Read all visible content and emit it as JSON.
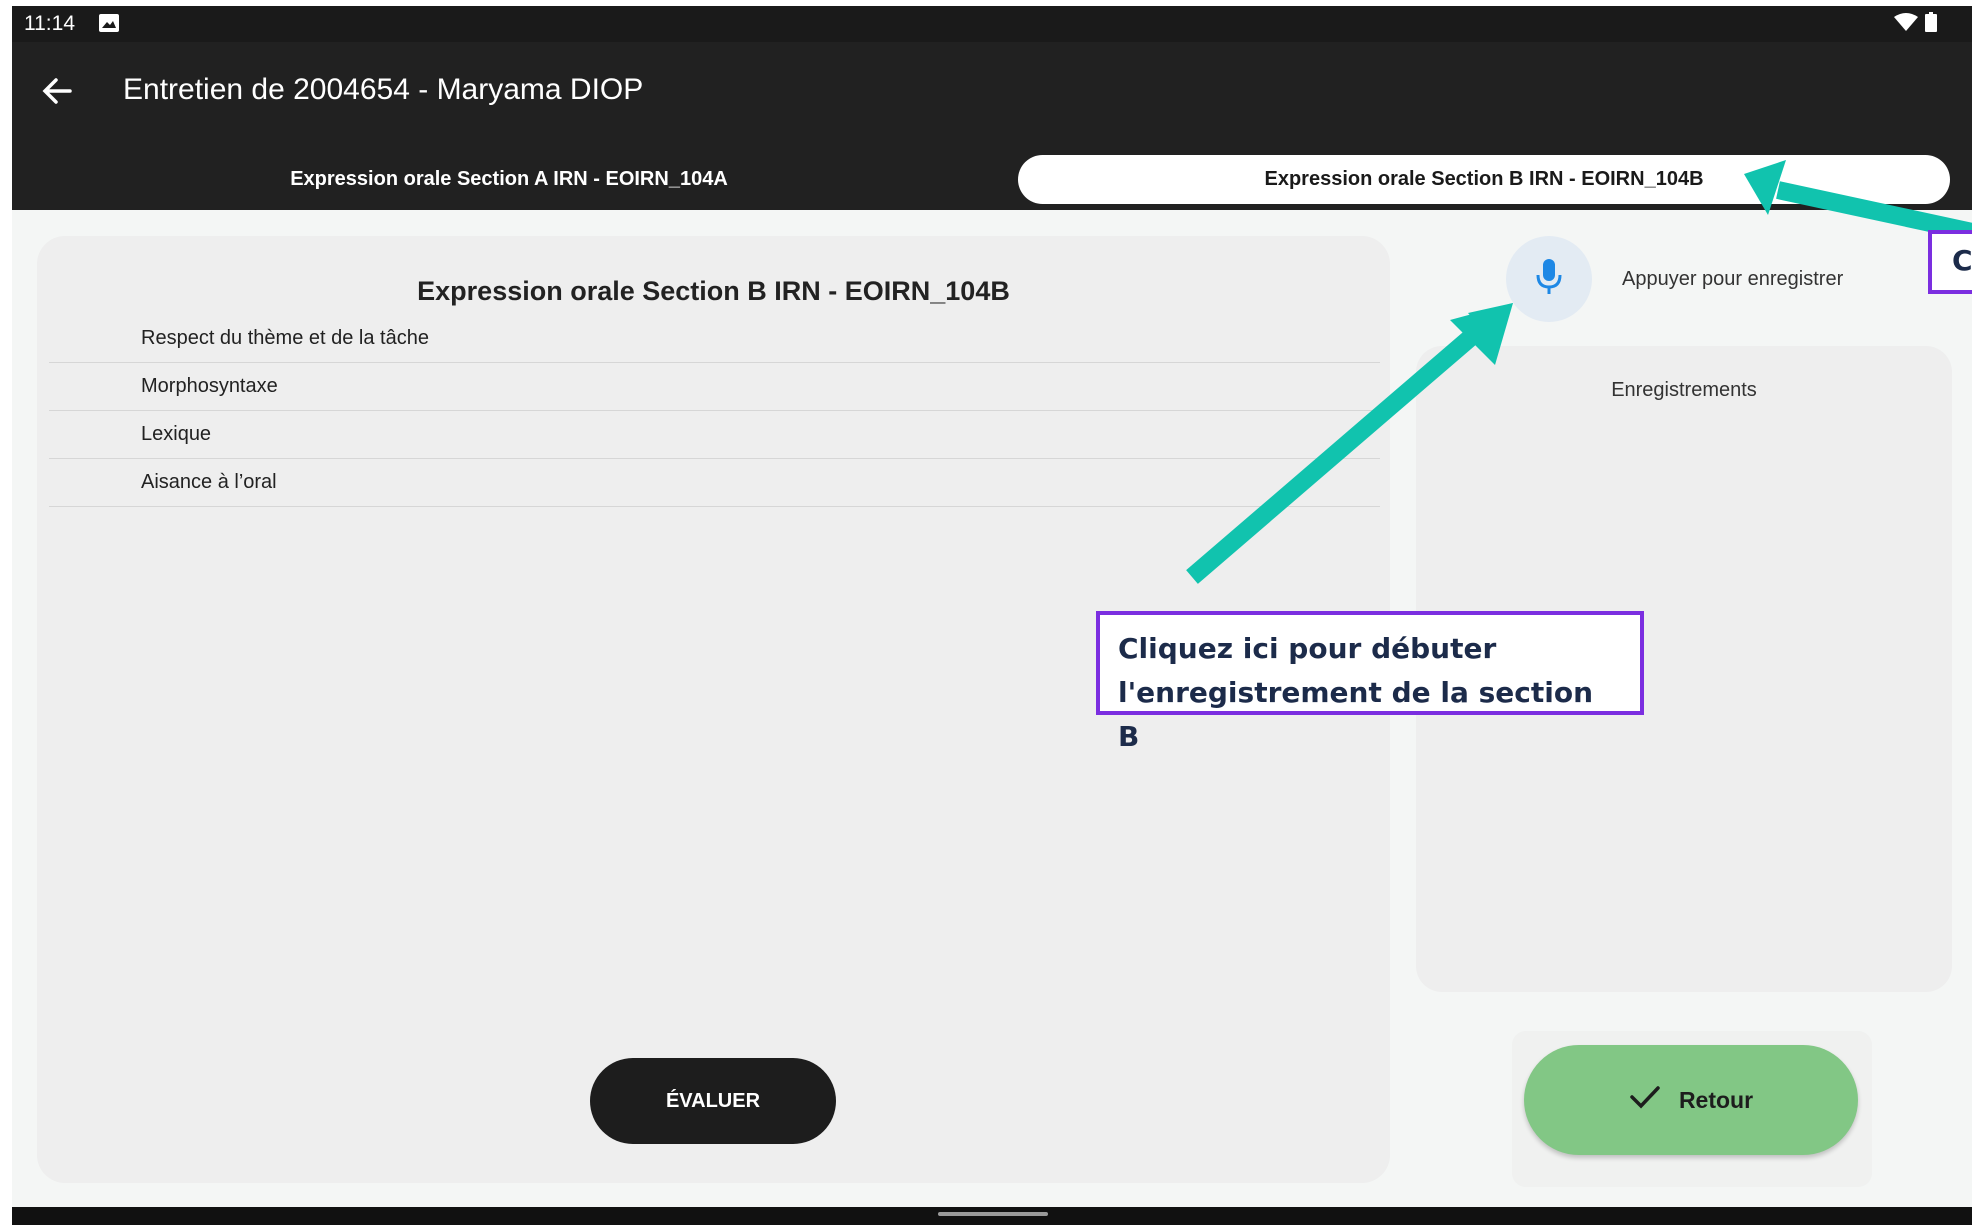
{
  "status_bar": {
    "time": "11:14"
  },
  "app_bar": {
    "title": "Entretien de 2004654 - Maryama DIOP"
  },
  "tabs": [
    {
      "label": "Expression orale Section A IRN - EOIRN_104A",
      "selected": false
    },
    {
      "label": "Expression orale Section B IRN - EOIRN_104B",
      "selected": true
    }
  ],
  "section_card": {
    "title": "Expression orale Section B IRN - EOIRN_104B",
    "criteria": [
      "Respect du thème et de la tâche",
      "Morphosyntaxe",
      "Lexique",
      "Aisance à l’oral"
    ],
    "evaluate_label": "ÉVALUER"
  },
  "recorder": {
    "label": "Appuyer pour enregistrer",
    "recordings_title": "Enregistrements"
  },
  "footer": {
    "retour_label": "Retour"
  },
  "annotations": {
    "mic_callout_line1": "Cliquez ici pour débuter",
    "mic_callout_line2": "l'enregistrement de la section B",
    "tab_callout_letter": "C"
  },
  "colors": {
    "app_bar": "#212121",
    "retour_button": "#82c785",
    "arrow": "#11c3ae",
    "annotation_border": "#7b2ee0",
    "mic_icon": "#1e88e5"
  },
  "icons": [
    "back-arrow-icon",
    "image-icon",
    "wifi-icon",
    "battery-icon",
    "microphone-icon",
    "check-icon"
  ]
}
